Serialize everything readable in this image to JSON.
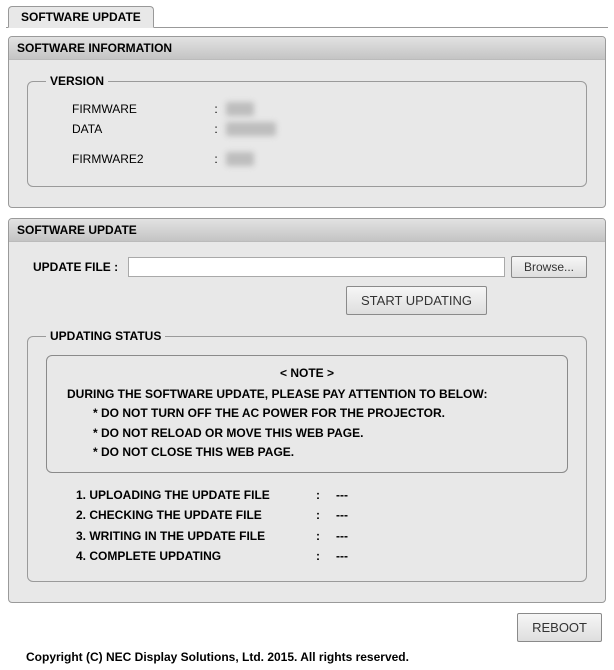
{
  "tab": {
    "label": "SOFTWARE UPDATE"
  },
  "info_panel": {
    "title": "SOFTWARE INFORMATION",
    "version_legend": "VERSION",
    "rows": {
      "firmware_label": "FIRMWARE",
      "firmware_value": "xx",
      "data_label": "DATA",
      "data_value": "xxxxx",
      "firmware2_label": "FIRMWARE2",
      "firmware2_value": "xx"
    }
  },
  "update_panel": {
    "title": "SOFTWARE UPDATE",
    "file_label": "UPDATE FILE :",
    "file_value": "",
    "browse_label": "Browse...",
    "start_label": "START UPDATING",
    "status_legend": "UPDATING STATUS",
    "note": {
      "title": "< NOTE >",
      "heading": "DURING THE SOFTWARE UPDATE, PLEASE PAY ATTENTION TO BELOW:",
      "line1": "* DO NOT TURN OFF THE AC POWER FOR THE PROJECTOR.",
      "line2": "* DO NOT RELOAD OR MOVE THIS WEB PAGE.",
      "line3": "* DO NOT CLOSE THIS WEB PAGE."
    },
    "steps": {
      "s1_label": "1. UPLOADING THE UPDATE FILE",
      "s1_value": "---",
      "s2_label": "2. CHECKING THE UPDATE FILE",
      "s2_value": "---",
      "s3_label": "3. WRITING IN THE UPDATE FILE",
      "s3_value": "---",
      "s4_label": "4. COMPLETE UPDATING",
      "s4_value": "---"
    },
    "reboot_label": "REBOOT"
  },
  "copyright": "Copyright (C) NEC Display Solutions, Ltd. 2015. All rights reserved."
}
